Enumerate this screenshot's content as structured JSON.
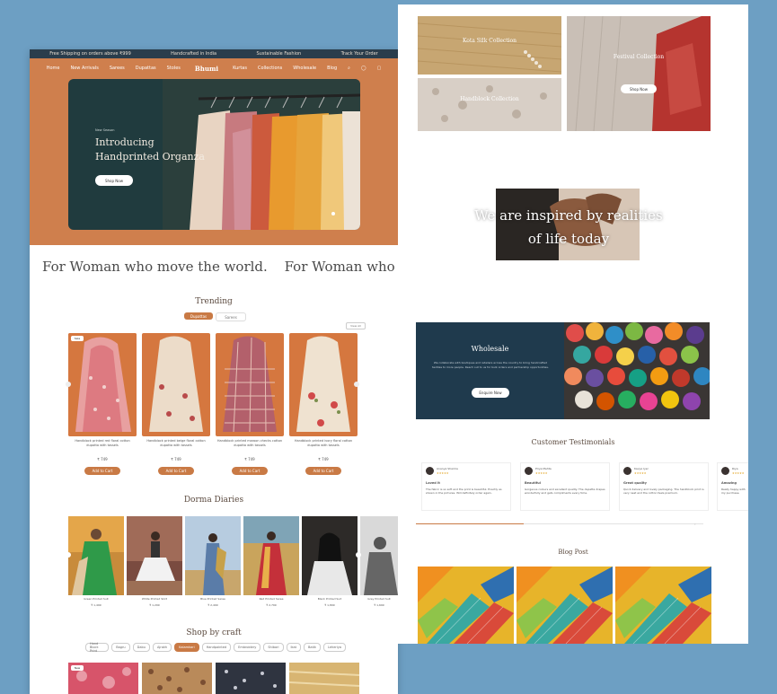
{
  "topbar": {
    "items": [
      "Free Shipping on orders above ₹999",
      "Handcrafted in India",
      "Sustainable Fashion",
      "Track Your Order"
    ]
  },
  "nav": {
    "left_links": [
      "Home",
      "New Arrivals",
      "Sarees",
      "Dupattas",
      "Stoles"
    ],
    "brand": "Bhumi",
    "right_links": [
      "Kurtas",
      "Collections",
      "Wholesale",
      "Blog"
    ]
  },
  "hero": {
    "eyebrow": "New Season",
    "title_line1": "Introducing",
    "title_line2": "Handprinted Organza",
    "cta": "Shop Now"
  },
  "marquee": {
    "text1": "For Woman who move the world.",
    "text2": "For Woman who move the world."
  },
  "trending": {
    "title": "Trending",
    "tabs": [
      "Dupattas",
      "Sarees"
    ],
    "view_all": "View All",
    "badge": "Sale",
    "products": [
      {
        "name": "Handblock printed red floral cotton dupatta with tassels",
        "price": "₹ 749",
        "button": "Add to Cart"
      },
      {
        "name": "Handblock printed beige floral cotton dupatta with tassels",
        "price": "₹ 749",
        "button": "Add to Cart"
      },
      {
        "name": "Handblock printed maroon checks cotton dupatta with tassels",
        "price": "₹ 749",
        "button": "Add to Cart"
      },
      {
        "name": "Handblock printed ivory floral cotton dupatta with tassels",
        "price": "₹ 749",
        "button": "Add to Cart"
      }
    ]
  },
  "diaries": {
    "title": "Dorma Diaries",
    "items": [
      {
        "name": "Green Printed Suit",
        "price": "₹ 1,499"
      },
      {
        "name": "White Printed Skirt",
        "price": "₹ 1,299"
      },
      {
        "name": "Blue Printed Saree",
        "price": "₹ 2,499"
      },
      {
        "name": "Red Printed Saree",
        "price": "₹ 2,799"
      },
      {
        "name": "Black Printed Suit",
        "price": "₹ 1,899"
      },
      {
        "name": "Grey Printed Suit",
        "price": "₹ 1,699"
      }
    ]
  },
  "shop_by_craft": {
    "title": "Shop by craft",
    "chips": [
      "Hand Block Print",
      "Bagru",
      "Dabu",
      "Ajrakh",
      "Kalamkari",
      "Handpainted",
      "Embroidery",
      "Shibori",
      "Ikat",
      "Batik",
      "Leheriya"
    ],
    "active_chip": "Kalamkari",
    "badge": "New"
  },
  "collections": {
    "c1": "Kota Silk Collection",
    "c2": "Festival Collection",
    "c3": "Handblock Collection",
    "cta": "Shop Now"
  },
  "inspired": {
    "line1": "We are inspired by realities",
    "line2": "of life today"
  },
  "wholesale": {
    "title": "Wholesale",
    "text": "We collaborate with boutiques and retailers across the country to bring handcrafted textiles to more people. Reach out to us for bulk orders and partnership opportunities.",
    "cta": "Enquire Now"
  },
  "testimonials": {
    "title": "Customer Testimonials",
    "items": [
      {
        "name": "Ananya Sharma",
        "stars": "★★★★★",
        "label": "Loved it",
        "text": "The fabric is so soft and the print is beautiful. Exactly as shown in the pictures. Will definitely order again."
      },
      {
        "name": "Priya Mehta",
        "stars": "★★★★★",
        "label": "Beautiful",
        "text": "Gorgeous colours and excellent quality. The dupatta drapes wonderfully and gets compliments every time."
      },
      {
        "name": "Kavya Iyer",
        "stars": "★★★★★",
        "label": "Great quality",
        "text": "Quick delivery and lovely packaging. The handblock print is very neat and the cotton feels premium."
      },
      {
        "name": "Riya",
        "stars": "★★★★★",
        "label": "Amazing",
        "text": "Really happy with my purchase."
      }
    ]
  },
  "blog": {
    "title": "Blog Post"
  },
  "colors": {
    "accent": "#c97a45",
    "navy": "#1f3a4d",
    "hero_bg": "#203b3e"
  }
}
